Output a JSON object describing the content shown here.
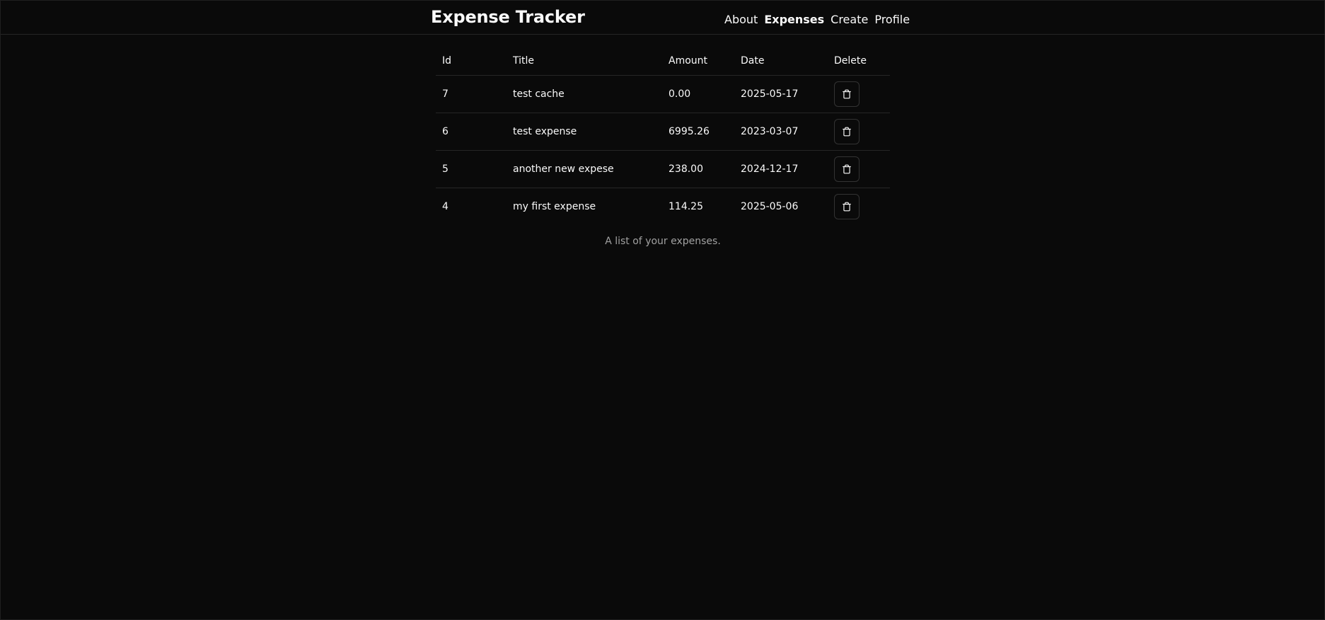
{
  "app": {
    "title": "Expense Tracker"
  },
  "nav": {
    "items": [
      {
        "label": "About",
        "active": false
      },
      {
        "label": "Expenses",
        "active": true
      },
      {
        "label": "Create",
        "active": false
      },
      {
        "label": "Profile",
        "active": false
      }
    ]
  },
  "table": {
    "headers": {
      "id": "Id",
      "title": "Title",
      "amount": "Amount",
      "date": "Date",
      "delete": "Delete"
    },
    "rows": [
      {
        "id": "7",
        "title": "test cache",
        "amount": "0.00",
        "date": "2025-05-17"
      },
      {
        "id": "6",
        "title": "test expense",
        "amount": "6995.26",
        "date": "2023-03-07"
      },
      {
        "id": "5",
        "title": "another new expese",
        "amount": "238.00",
        "date": "2024-12-17"
      },
      {
        "id": "4",
        "title": "my first expense",
        "amount": "114.25",
        "date": "2025-05-06"
      }
    ],
    "caption": "A list of your expenses.",
    "delete_icon": "trash-icon"
  },
  "colors": {
    "background": "#0a0a0a",
    "text": "#fafafa",
    "muted": "#a1a1a1",
    "border": "#262626"
  }
}
